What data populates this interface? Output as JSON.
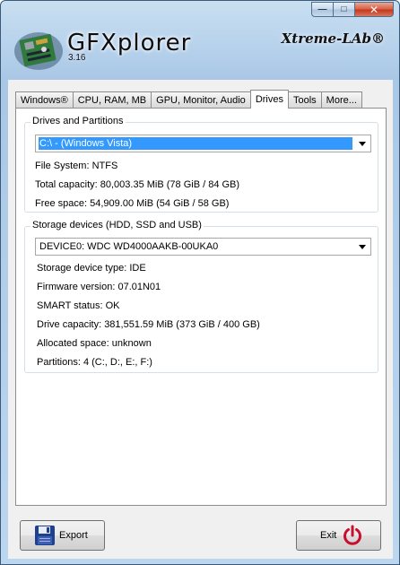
{
  "window": {
    "app_name": "GFXplorer",
    "version": "3.16",
    "brand": "Xtreme-LAb®",
    "minimize_glyph": "—",
    "maximize_glyph": "□",
    "close_glyph": "✕"
  },
  "tabs": [
    {
      "label": "Windows®",
      "active": false
    },
    {
      "label": "CPU, RAM, MB",
      "active": false
    },
    {
      "label": "GPU, Monitor, Audio",
      "active": false
    },
    {
      "label": "Drives",
      "active": true
    },
    {
      "label": "Tools",
      "active": false
    },
    {
      "label": "More...",
      "active": false
    }
  ],
  "drives": {
    "group_title": "Drives and Partitions",
    "selected_drive": "C:\\ - (Windows Vista)",
    "file_system": "File System: NTFS",
    "total_capacity": "Total capacity: 80,003.35 MiB (78 GiB / 84 GB)",
    "free_space": "Free space: 54,909.00 MiB (54 GiB / 58 GB)"
  },
  "storage": {
    "group_title": "Storage devices (HDD, SSD and USB)",
    "selected_device": "DEVICE0: WDC WD4000AAKB-00UKA0",
    "device_type": "Storage device type: IDE",
    "firmware": "Firmware version: 07.01N01",
    "smart": "SMART status: OK",
    "capacity": "Drive capacity: 381,551.59 MiB (373 GiB / 400 GB)",
    "allocated": "Allocated space: unknown",
    "partitions": "Partitions: 4 (C:, D:, E:, F:)"
  },
  "buttons": {
    "export_label": "Export",
    "exit_label": "Exit"
  },
  "icons": {
    "app_logo": "motherboard-icon",
    "export": "floppy-disk-icon",
    "exit": "power-icon",
    "combo_arrow": "chevron-down-icon"
  },
  "colors": {
    "selection": "#3399ff",
    "exit_icon": "#c8102e",
    "export_icon": "#1f3f8f"
  }
}
